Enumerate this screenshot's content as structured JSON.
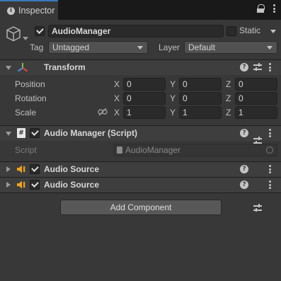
{
  "tab": {
    "title": "Inspector"
  },
  "header": {
    "object_name": "AudioManager",
    "static_label": "Static",
    "tag_label": "Tag",
    "tag_value": "Untagged",
    "layer_label": "Layer",
    "layer_value": "Default"
  },
  "transform": {
    "title": "Transform",
    "rows": [
      {
        "label": "Position",
        "x": "0",
        "y": "0",
        "z": "0"
      },
      {
        "label": "Rotation",
        "x": "0",
        "y": "0",
        "z": "0"
      },
      {
        "label": "Scale",
        "x": "1",
        "y": "1",
        "z": "1"
      }
    ],
    "axes": {
      "x": "X",
      "y": "Y",
      "z": "Z"
    }
  },
  "audio_manager": {
    "title": "Audio Manager (Script)",
    "script_label": "Script",
    "script_value": "AudioManager"
  },
  "audio_sources": [
    {
      "title": "Audio Source"
    },
    {
      "title": "Audio Source"
    }
  ],
  "add_component_label": "Add Component",
  "colors": {
    "tab_accent": "#3a79bb",
    "panel_bg": "#383838",
    "audio_icon": "#f2a31b"
  }
}
